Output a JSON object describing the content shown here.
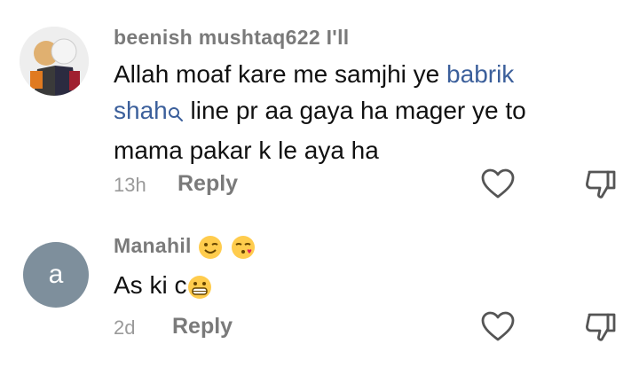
{
  "comments": [
    {
      "username": "beenish mushtaq622 I'll",
      "text_line1_before": "Allah moaf kare me samjhi ye ",
      "mention_line1": "babrik",
      "mention_line2": "shah",
      "text_line2_after": " line pr aa gaya ha mager ye to",
      "text_line3": "mama pakar k le aya ha",
      "time": "13h",
      "reply_label": "Reply"
    },
    {
      "avatar_letter": "a",
      "username": "Manahil",
      "username_emojis": [
        "winking-face-emoji",
        "face-blowing-kiss-emoji"
      ],
      "text": "As ki c",
      "text_emoji": "grinning-face-emoji",
      "time": "2d",
      "reply_label": "Reply"
    }
  ],
  "colors": {
    "username": "#7a7a7a",
    "mention": "#3b5f9b",
    "avatar_bg": "#7e8f9c"
  }
}
